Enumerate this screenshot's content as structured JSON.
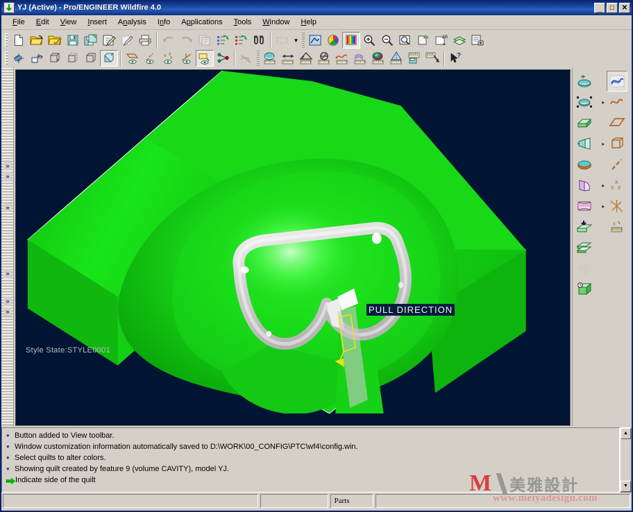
{
  "window": {
    "title": "YJ (Active) - Pro/ENGINEER Wildfire 4.0",
    "app_icon": "proe-window-icon",
    "minimize_label": "_",
    "maximize_label": "□",
    "close_label": "✕"
  },
  "menubar": {
    "items": [
      {
        "label": "File",
        "accel": "F"
      },
      {
        "label": "Edit",
        "accel": "E"
      },
      {
        "label": "View",
        "accel": "V"
      },
      {
        "label": "Insert",
        "accel": "I"
      },
      {
        "label": "Analysis",
        "accel": "A"
      },
      {
        "label": "Info",
        "accel": "n"
      },
      {
        "label": "Applications",
        "accel": "p"
      },
      {
        "label": "Tools",
        "accel": "T"
      },
      {
        "label": "Window",
        "accel": "W"
      },
      {
        "label": "Help",
        "accel": "H"
      }
    ]
  },
  "toolbar_row1": [
    {
      "name": "new-file-icon",
      "title": "New"
    },
    {
      "name": "open-file-icon",
      "title": "Open"
    },
    {
      "name": "save-as-folder-icon",
      "title": "Set Working Directory"
    },
    {
      "name": "save-icon",
      "title": "Save"
    },
    {
      "name": "save-a-copy-icon",
      "title": "Save a Copy"
    },
    {
      "name": "print-preview-icon",
      "title": "Print Preview"
    },
    {
      "name": "erase-icon",
      "title": "Erase"
    },
    {
      "name": "print-icon",
      "title": "Print"
    },
    {
      "name": "undo-icon",
      "title": "Undo",
      "disabled": true
    },
    {
      "name": "redo-icon",
      "title": "Redo",
      "disabled": true
    },
    {
      "name": "copy-icon",
      "title": "Copy",
      "disabled": true
    },
    {
      "name": "regenerate-icon",
      "title": "Regenerate"
    },
    {
      "name": "regenerate-red-icon",
      "title": "Regenerate Manual"
    },
    {
      "name": "find-icon",
      "title": "Find"
    },
    {
      "name": "repaint-icon",
      "title": "Repaint",
      "disabled": true
    }
  ],
  "toolbar_row1b": [
    {
      "name": "sketcher-display-icon",
      "title": "Sketcher Display"
    },
    {
      "name": "color-appearance-icon",
      "title": "Appearance Gallery"
    },
    {
      "name": "color-spectrum-icon",
      "title": "Color and Appearance",
      "active": true
    },
    {
      "name": "zoom-in-icon",
      "title": "Zoom In"
    },
    {
      "name": "zoom-out-icon",
      "title": "Zoom Out"
    },
    {
      "name": "refit-icon",
      "title": "Refit"
    },
    {
      "name": "saved-view-icon",
      "title": "Saved View List"
    },
    {
      "name": "annotation-icon",
      "title": "Annotation Display"
    },
    {
      "name": "layers-icon",
      "title": "Layers"
    },
    {
      "name": "model-tree-icon",
      "title": "Model Tree Setup"
    }
  ],
  "toolbar_row2": [
    {
      "name": "spin-center-icon",
      "title": "Spin Center"
    },
    {
      "name": "orient-mode-icon",
      "title": "Orient Mode"
    },
    {
      "name": "wireframe-icon",
      "title": "Wireframe"
    },
    {
      "name": "hidden-line-icon",
      "title": "Hidden Line"
    },
    {
      "name": "no-hidden-icon",
      "title": "No Hidden"
    },
    {
      "name": "shading-icon",
      "title": "Shading",
      "active": true
    }
  ],
  "toolbar_row2b": [
    {
      "name": "datum-plane-display-icon",
      "title": "Datum Plane Display"
    },
    {
      "name": "datum-axis-display-icon",
      "title": "Datum Axis Display"
    },
    {
      "name": "datum-point-display-icon",
      "title": "Datum Point Display"
    },
    {
      "name": "datum-csys-display-icon",
      "title": "Coordinate System Display"
    },
    {
      "name": "annotation-display-icon",
      "title": "Annotation Display",
      "active": true
    },
    {
      "name": "chain-display-icon",
      "title": "Chain Display"
    },
    {
      "name": "hide-icon",
      "title": "Hide",
      "disabled": true
    },
    {
      "name": "measure-surface-icon",
      "title": "Measure Area"
    },
    {
      "name": "measure-distance-icon",
      "title": "Measure Distance"
    },
    {
      "name": "measure-angle-icon",
      "title": "Measure Angle"
    },
    {
      "name": "measure-diameter-icon",
      "title": "Measure Diameter"
    },
    {
      "name": "measure-curve-icon",
      "title": "Measure Curve Length"
    },
    {
      "name": "curvature-analysis-icon",
      "title": "Curvature Analysis"
    },
    {
      "name": "surface-analysis-icon",
      "title": "Surface Analysis"
    },
    {
      "name": "draft-check-icon",
      "title": "Draft Check"
    },
    {
      "name": "saved-analysis-icon",
      "title": "Saved Analysis"
    },
    {
      "name": "delete-analysis-icon",
      "title": "Delete Analysis"
    },
    {
      "name": "context-help-icon",
      "title": "Context Sensitive Help"
    }
  ],
  "left_rail": {
    "chevrons": [
      "»",
      "»",
      "»",
      "»",
      "»",
      "»"
    ]
  },
  "right_toolbar": {
    "column1": [
      {
        "name": "style-surface-icon",
        "title": "Style Surface"
      },
      {
        "name": "free-form-icon",
        "title": "Free Form",
        "flyout": true
      },
      {
        "name": "extrude-icon",
        "title": "Extrude"
      },
      {
        "name": "revolve-icon",
        "title": "Revolve",
        "flyout": true
      },
      {
        "name": "blend-icon",
        "title": "Blend"
      },
      {
        "name": "swept-blend-icon",
        "title": "Swept Blend"
      },
      {
        "name": "variable-section-sweep-icon",
        "title": "Variable Section Sweep",
        "flyout": true
      },
      {
        "name": "boundary-blend-icon",
        "title": "Boundary Blend"
      },
      {
        "name": "merge-quilt-icon",
        "title": "Merge Quilt"
      },
      {
        "name": "trim-icon",
        "title": "Trim",
        "disabled": true
      },
      {
        "name": "solidify-icon",
        "title": "Solidify"
      }
    ],
    "column2": [
      {
        "name": "style-icon",
        "title": "Style",
        "selected": true
      },
      {
        "name": "curve-icon",
        "title": "Sketched Curve",
        "flyout": true
      },
      {
        "name": "datum-plane-icon",
        "title": "Datum Plane"
      },
      {
        "name": "datum-csys-icon",
        "title": "Coordinate System",
        "flyout": true
      },
      {
        "name": "datum-axis-icon",
        "title": "Datum Axis"
      },
      {
        "name": "datum-point-icon",
        "title": "Datum Point",
        "flyout": true
      },
      {
        "name": "reference-point-icon",
        "title": "Offset Csys Datum Point",
        "flyout": true
      },
      {
        "name": "field-point-icon",
        "title": "Field Point"
      }
    ]
  },
  "viewport": {
    "background_color": "#001433",
    "style_state_label": "Style State:STYLE0001",
    "pull_direction_label": "PULL DIRECTION",
    "model_colors": {
      "quilt_green": "#17dd17",
      "quilt_green_dark": "#0bb00b",
      "surface_silver": "#d8d8d8",
      "highlight_white": "#ffffff",
      "arrow_yellow": "#e5e51a"
    }
  },
  "messages": {
    "items": [
      {
        "type": "info",
        "text": "Button added to View toolbar."
      },
      {
        "type": "info",
        "text": "Window customization information automatically saved to D:\\WORK\\00_CONFIG\\PTC\\wf4\\config.win."
      },
      {
        "type": "info",
        "text": "Select quilts to alter colors."
      },
      {
        "type": "info",
        "text": "Showing quilt created by feature 9 (volume CAVITY), model YJ."
      },
      {
        "type": "prompt",
        "text": "Indicate side of the quilt"
      }
    ],
    "scroll_up_label": "▲",
    "scroll_down_label": "▼"
  },
  "statusbar": {
    "left_text": "",
    "mid_text": "",
    "selection_text": "Parts",
    "right_text": ""
  },
  "watermark": {
    "logo_letter": "M",
    "company_cn": "美雅設計",
    "url": "www.meiyadesign.com",
    "color_red": "#d91f26",
    "color_gray": "#8a8a8a"
  }
}
